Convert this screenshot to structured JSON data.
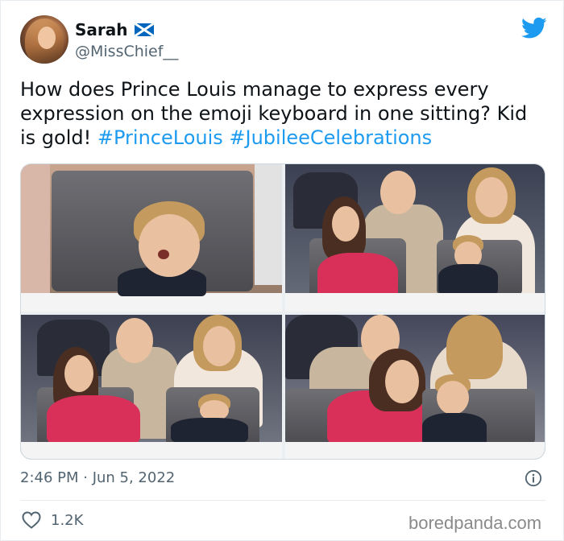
{
  "user": {
    "display_name": "Sarah",
    "handle": "@MissChief__",
    "flag_icon": "scotland-flag-icon"
  },
  "platform_icon": "twitter-bird-icon",
  "tweet": {
    "text_plain": "How does Prince Louis manage to express every expression on the emoji keyboard in one sitting? Kid is gold! ",
    "hashtags": [
      "#PrinceLouis",
      "#JubileeCelebrations"
    ]
  },
  "media": {
    "photo_count": 4
  },
  "meta": {
    "timestamp": "2:46 PM · Jun 5, 2022",
    "info_icon": "info-icon"
  },
  "engagement": {
    "like_icon": "heart-icon",
    "likes": "1.2K"
  },
  "watermark": "boredpanda.com",
  "colors": {
    "accent": "#1d9bf0",
    "text": "#0f1419",
    "muted": "#536471"
  }
}
